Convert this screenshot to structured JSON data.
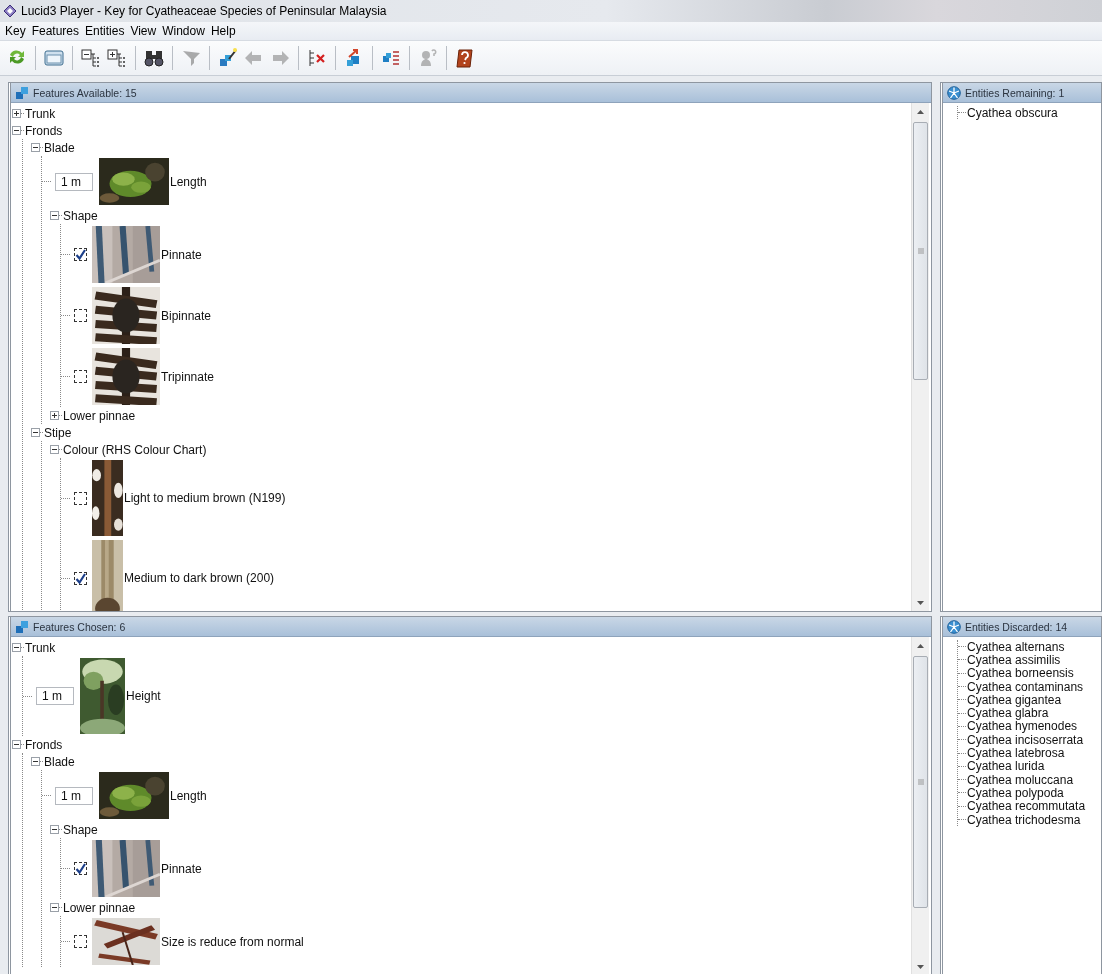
{
  "window": {
    "title": "Lucid3 Player - Key for Cyatheaceae Species of Peninsular Malaysia"
  },
  "menu": [
    "Key",
    "Features",
    "Entities",
    "View",
    "Window",
    "Help"
  ],
  "toolbar": [
    [
      {
        "kind": "restart",
        "disabled": false
      }
    ],
    [
      {
        "kind": "open",
        "disabled": false
      }
    ],
    [
      {
        "kind": "collapse",
        "disabled": false
      },
      {
        "kind": "expand",
        "disabled": false
      }
    ],
    [
      {
        "kind": "find",
        "disabled": false
      }
    ],
    [
      {
        "kind": "prune",
        "disabled": true
      }
    ],
    [
      {
        "kind": "best",
        "disabled": false
      },
      {
        "kind": "back",
        "disabled": true
      },
      {
        "kind": "forward",
        "disabled": true
      }
    ],
    [
      {
        "kind": "clear",
        "disabled": false
      }
    ],
    [
      {
        "kind": "promote",
        "disabled": false
      }
    ],
    [
      {
        "kind": "sort",
        "disabled": false
      }
    ],
    [
      {
        "kind": "differences",
        "disabled": true
      }
    ],
    [
      {
        "kind": "help",
        "disabled": false
      }
    ]
  ],
  "features_available": {
    "title": "Features Available: 15",
    "tree": [
      {
        "kind": "group",
        "label": "Trunk",
        "expanded": false
      },
      {
        "kind": "group",
        "label": "Fronds",
        "expanded": true,
        "children": [
          {
            "kind": "group",
            "label": "Blade",
            "expanded": true,
            "children": [
              {
                "kind": "numeric",
                "value": "1 m",
                "label": "Length"
              },
              {
                "kind": "group",
                "label": "Shape",
                "expanded": true,
                "children": [
                  {
                    "kind": "state",
                    "label": "Pinnate",
                    "checked": true
                  },
                  {
                    "kind": "state",
                    "label": "Bipinnate",
                    "checked": false
                  },
                  {
                    "kind": "state",
                    "label": "Tripinnate",
                    "checked": false
                  }
                ]
              },
              {
                "kind": "group",
                "label": "Lower pinnae",
                "expanded": false
              }
            ]
          },
          {
            "kind": "group",
            "label": "Stipe",
            "expanded": true,
            "children": [
              {
                "kind": "group",
                "label": "Colour (RHS Colour Chart)",
                "expanded": true,
                "children": [
                  {
                    "kind": "state",
                    "label": "Light to medium brown (N199)",
                    "checked": false
                  },
                  {
                    "kind": "state",
                    "label": "Medium to dark brown (200)",
                    "checked": true
                  }
                ]
              }
            ]
          }
        ]
      }
    ]
  },
  "entities_remaining": {
    "title": "Entities Remaining: 1",
    "items": [
      "Cyathea obscura"
    ]
  },
  "features_chosen": {
    "title": "Features Chosen: 6",
    "tree": [
      {
        "kind": "group",
        "label": "Trunk",
        "expanded": true,
        "children": [
          {
            "kind": "numeric",
            "value": "1 m",
            "label": "Height"
          }
        ]
      },
      {
        "kind": "group",
        "label": "Fronds",
        "expanded": true,
        "children": [
          {
            "kind": "group",
            "label": "Blade",
            "expanded": true,
            "children": [
              {
                "kind": "numeric",
                "value": "1 m",
                "label": "Length"
              },
              {
                "kind": "group",
                "label": "Shape",
                "expanded": true,
                "children": [
                  {
                    "kind": "state",
                    "label": "Pinnate",
                    "checked": true
                  }
                ]
              },
              {
                "kind": "group",
                "label": "Lower pinnae",
                "expanded": true,
                "children": [
                  {
                    "kind": "state",
                    "label": "Size is reduce from normal",
                    "checked": false
                  }
                ]
              }
            ]
          }
        ]
      }
    ]
  },
  "entities_discarded": {
    "title": "Entities Discarded: 14",
    "items": [
      "Cyathea alternans",
      "Cyathea assimilis",
      "Cyathea borneensis",
      "Cyathea contaminans",
      "Cyathea gigantea",
      "Cyathea glabra",
      "Cyathea hymenodes",
      "Cyathea incisoserrata",
      "Cyathea latebrosa",
      "Cyathea lurida",
      "Cyathea moluccana",
      "Cyathea polypoda",
      "Cyathea recommutata",
      "Cyathea trichodesma"
    ]
  }
}
